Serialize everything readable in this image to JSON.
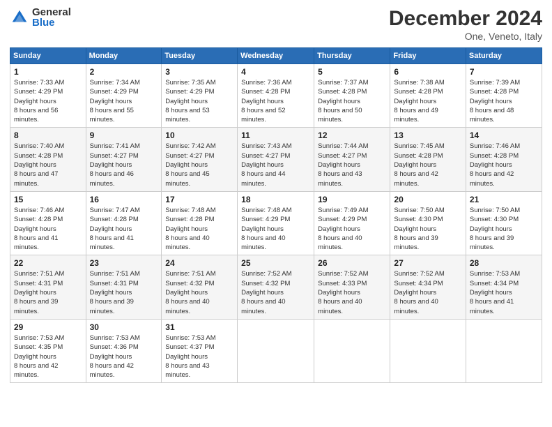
{
  "logo": {
    "general": "General",
    "blue": "Blue"
  },
  "header": {
    "title": "December 2024",
    "location": "One, Veneto, Italy"
  },
  "weekdays": [
    "Sunday",
    "Monday",
    "Tuesday",
    "Wednesday",
    "Thursday",
    "Friday",
    "Saturday"
  ],
  "weeks": [
    [
      {
        "day": "1",
        "sunrise": "7:33 AM",
        "sunset": "4:29 PM",
        "daylight": "8 hours and 56 minutes."
      },
      {
        "day": "2",
        "sunrise": "7:34 AM",
        "sunset": "4:29 PM",
        "daylight": "8 hours and 55 minutes."
      },
      {
        "day": "3",
        "sunrise": "7:35 AM",
        "sunset": "4:29 PM",
        "daylight": "8 hours and 53 minutes."
      },
      {
        "day": "4",
        "sunrise": "7:36 AM",
        "sunset": "4:28 PM",
        "daylight": "8 hours and 52 minutes."
      },
      {
        "day": "5",
        "sunrise": "7:37 AM",
        "sunset": "4:28 PM",
        "daylight": "8 hours and 50 minutes."
      },
      {
        "day": "6",
        "sunrise": "7:38 AM",
        "sunset": "4:28 PM",
        "daylight": "8 hours and 49 minutes."
      },
      {
        "day": "7",
        "sunrise": "7:39 AM",
        "sunset": "4:28 PM",
        "daylight": "8 hours and 48 minutes."
      }
    ],
    [
      {
        "day": "8",
        "sunrise": "7:40 AM",
        "sunset": "4:28 PM",
        "daylight": "8 hours and 47 minutes."
      },
      {
        "day": "9",
        "sunrise": "7:41 AM",
        "sunset": "4:27 PM",
        "daylight": "8 hours and 46 minutes."
      },
      {
        "day": "10",
        "sunrise": "7:42 AM",
        "sunset": "4:27 PM",
        "daylight": "8 hours and 45 minutes."
      },
      {
        "day": "11",
        "sunrise": "7:43 AM",
        "sunset": "4:27 PM",
        "daylight": "8 hours and 44 minutes."
      },
      {
        "day": "12",
        "sunrise": "7:44 AM",
        "sunset": "4:27 PM",
        "daylight": "8 hours and 43 minutes."
      },
      {
        "day": "13",
        "sunrise": "7:45 AM",
        "sunset": "4:28 PM",
        "daylight": "8 hours and 42 minutes."
      },
      {
        "day": "14",
        "sunrise": "7:46 AM",
        "sunset": "4:28 PM",
        "daylight": "8 hours and 42 minutes."
      }
    ],
    [
      {
        "day": "15",
        "sunrise": "7:46 AM",
        "sunset": "4:28 PM",
        "daylight": "8 hours and 41 minutes."
      },
      {
        "day": "16",
        "sunrise": "7:47 AM",
        "sunset": "4:28 PM",
        "daylight": "8 hours and 41 minutes."
      },
      {
        "day": "17",
        "sunrise": "7:48 AM",
        "sunset": "4:28 PM",
        "daylight": "8 hours and 40 minutes."
      },
      {
        "day": "18",
        "sunrise": "7:48 AM",
        "sunset": "4:29 PM",
        "daylight": "8 hours and 40 minutes."
      },
      {
        "day": "19",
        "sunrise": "7:49 AM",
        "sunset": "4:29 PM",
        "daylight": "8 hours and 40 minutes."
      },
      {
        "day": "20",
        "sunrise": "7:50 AM",
        "sunset": "4:30 PM",
        "daylight": "8 hours and 39 minutes."
      },
      {
        "day": "21",
        "sunrise": "7:50 AM",
        "sunset": "4:30 PM",
        "daylight": "8 hours and 39 minutes."
      }
    ],
    [
      {
        "day": "22",
        "sunrise": "7:51 AM",
        "sunset": "4:31 PM",
        "daylight": "8 hours and 39 minutes."
      },
      {
        "day": "23",
        "sunrise": "7:51 AM",
        "sunset": "4:31 PM",
        "daylight": "8 hours and 39 minutes."
      },
      {
        "day": "24",
        "sunrise": "7:51 AM",
        "sunset": "4:32 PM",
        "daylight": "8 hours and 40 minutes."
      },
      {
        "day": "25",
        "sunrise": "7:52 AM",
        "sunset": "4:32 PM",
        "daylight": "8 hours and 40 minutes."
      },
      {
        "day": "26",
        "sunrise": "7:52 AM",
        "sunset": "4:33 PM",
        "daylight": "8 hours and 40 minutes."
      },
      {
        "day": "27",
        "sunrise": "7:52 AM",
        "sunset": "4:34 PM",
        "daylight": "8 hours and 40 minutes."
      },
      {
        "day": "28",
        "sunrise": "7:53 AM",
        "sunset": "4:34 PM",
        "daylight": "8 hours and 41 minutes."
      }
    ],
    [
      {
        "day": "29",
        "sunrise": "7:53 AM",
        "sunset": "4:35 PM",
        "daylight": "8 hours and 42 minutes."
      },
      {
        "day": "30",
        "sunrise": "7:53 AM",
        "sunset": "4:36 PM",
        "daylight": "8 hours and 42 minutes."
      },
      {
        "day": "31",
        "sunrise": "7:53 AM",
        "sunset": "4:37 PM",
        "daylight": "8 hours and 43 minutes."
      },
      null,
      null,
      null,
      null
    ]
  ],
  "labels": {
    "sunrise": "Sunrise:",
    "sunset": "Sunset:",
    "daylight": "Daylight hours"
  }
}
